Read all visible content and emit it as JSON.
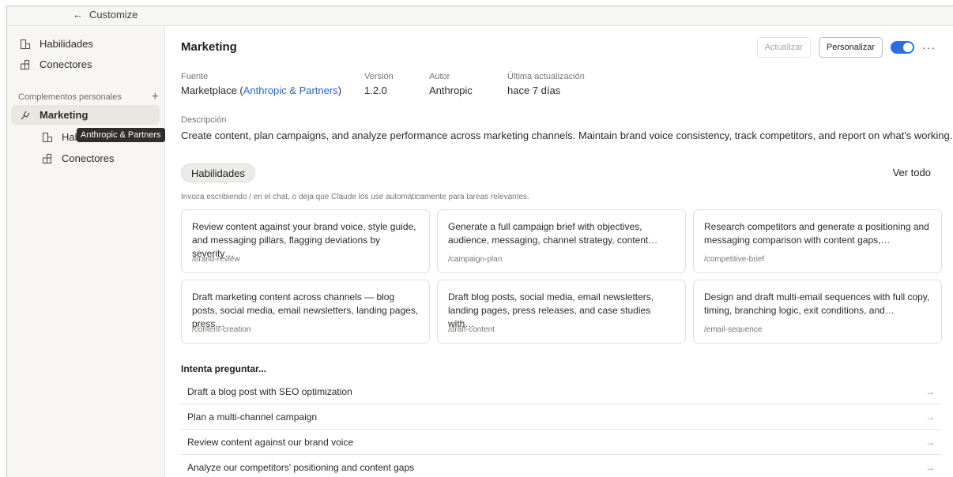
{
  "topbar": {
    "back_label": "Customize"
  },
  "sidebar": {
    "items": [
      {
        "label": "Habilidades"
      },
      {
        "label": "Conectores"
      }
    ],
    "section_title": "Complementos personales",
    "plugin": {
      "label": "Marketing",
      "children": [
        {
          "label": "Habilidades",
          "visible_label": "Habi"
        },
        {
          "label": "Conectores"
        }
      ]
    },
    "tooltip": "Anthropic & Partners"
  },
  "header": {
    "title": "Marketing",
    "update_label": "Actualizar",
    "customize_label": "Personalizar",
    "enabled": true
  },
  "meta": {
    "source_label": "Fuente",
    "source_prefix": "Marketplace (",
    "source_link": "Anthropic & Partners",
    "source_suffix": ")",
    "version_label": "Versión",
    "version_value": "1.2.0",
    "author_label": "Autor",
    "author_value": "Anthropic",
    "updated_label": "Última actualización",
    "updated_value": "hace 7 días"
  },
  "description": {
    "label": "Descripción",
    "text": "Create content, plan campaigns, and analyze performance across marketing channels. Maintain brand voice consistency, track competitors, and report on what's working."
  },
  "skills": {
    "tab_label": "Habilidades",
    "view_all": "Ver todo",
    "hint": "Invoca escribiendo / en el chat, o deja que Claude los use automáticamente para tareas relevantes.",
    "cards": [
      {
        "text": "Review content against your brand voice, style guide, and messaging pillars, flagging deviations by severity…",
        "command": "/brand-review"
      },
      {
        "text": "Generate a full campaign brief with objectives, audience, messaging, channel strategy, content…",
        "command": "/campaign-plan"
      },
      {
        "text": "Research competitors and generate a positioning and messaging comparison with content gaps,…",
        "command": "/competitive-brief"
      },
      {
        "text": "Draft marketing content across channels — blog posts, social media, email newsletters, landing pages, press…",
        "command": "/content-creation"
      },
      {
        "text": "Draft blog posts, social media, email newsletters, landing pages, press releases, and case studies with…",
        "command": "/draft-content"
      },
      {
        "text": "Design and draft multi-email sequences with full copy, timing, branching logic, exit conditions, and…",
        "command": "/email-sequence"
      }
    ]
  },
  "try_asking": {
    "title": "Intenta preguntar...",
    "prompts": [
      "Draft a blog post with SEO optimization",
      "Plan a multi-channel campaign",
      "Review content against our brand voice",
      "Analyze our competitors' positioning and content gaps"
    ]
  }
}
